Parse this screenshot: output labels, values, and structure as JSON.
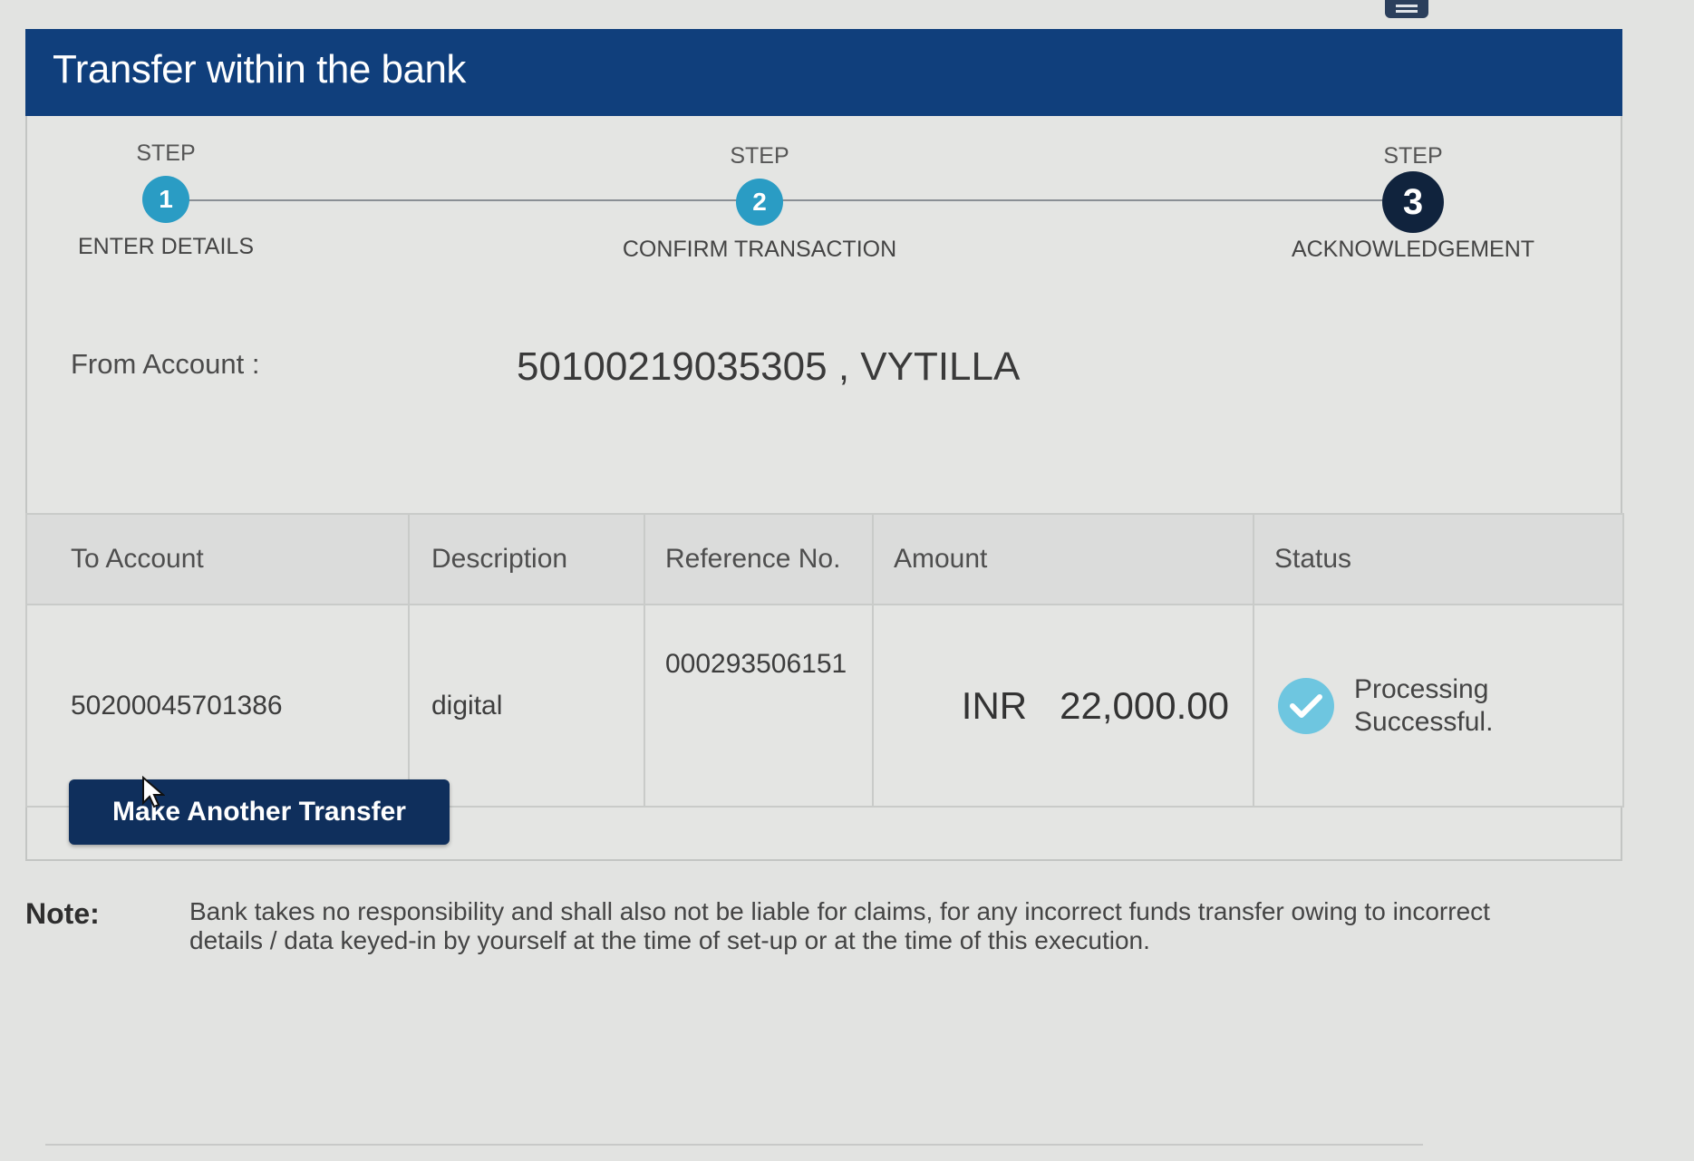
{
  "header": {
    "title": "Transfer within the bank"
  },
  "steps": [
    {
      "label": "STEP",
      "number": "1",
      "name": "ENTER DETAILS"
    },
    {
      "label": "STEP",
      "number": "2",
      "name": "CONFIRM TRANSACTION"
    },
    {
      "label": "STEP",
      "number": "3",
      "name": "ACKNOWLEDGEMENT"
    }
  ],
  "from_account": {
    "label": "From Account :",
    "value": "50100219035305 , VYTILLA"
  },
  "table": {
    "columns": [
      "To Account",
      "Description",
      "Reference No.",
      "Amount",
      "Status"
    ],
    "row": {
      "to_account": "50200045701386",
      "description": "digital",
      "reference_no": "000293506151",
      "currency": "INR",
      "amount": "22,000.00",
      "status_line1": "Processing",
      "status_line2": "Successful."
    }
  },
  "actions": {
    "make_another_transfer": "Make Another Transfer"
  },
  "note": {
    "label": "Note:",
    "text": "Bank takes no responsibility and shall also not be liable for claims, for any incorrect funds transfer owing to incorrect details / data keyed-in by yourself at the time of set-up or at the time of this execution."
  },
  "colors": {
    "header_bg": "#103f7c",
    "step_done": "#2a9cc4",
    "step_active": "#10233d",
    "button_bg": "#0f2f5c",
    "status_check": "#6ec6e0"
  },
  "icons": [
    "menu-icon",
    "check-circle-icon",
    "cursor-icon"
  ]
}
